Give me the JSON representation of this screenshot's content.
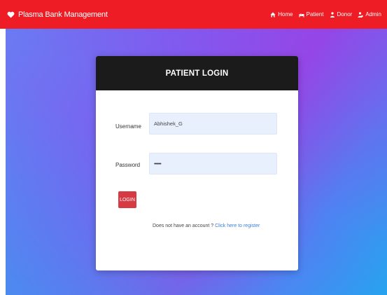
{
  "navbar": {
    "brand": "Plasma Bank Management",
    "links": [
      {
        "label": "Home",
        "icon": "home-icon"
      },
      {
        "label": "Patient",
        "icon": "patient-icon"
      },
      {
        "label": "Donor",
        "icon": "donor-icon"
      },
      {
        "label": "Admin",
        "icon": "admin-icon"
      }
    ]
  },
  "login_card": {
    "title": "PATIENT LOGIN",
    "username_label": "Username",
    "username_value": "Abhishek_G",
    "password_label": "Password",
    "password_value": "••••••",
    "login_button": "LOGIN",
    "register_prompt": "Does not have an account ?",
    "register_link": "Click here to register"
  },
  "colors": {
    "navbar": "#ee1c25",
    "card_header": "#1b1b1b",
    "login_button": "#d63a43",
    "input_bg": "#e8f0fe",
    "link": "#3b7fd8"
  }
}
